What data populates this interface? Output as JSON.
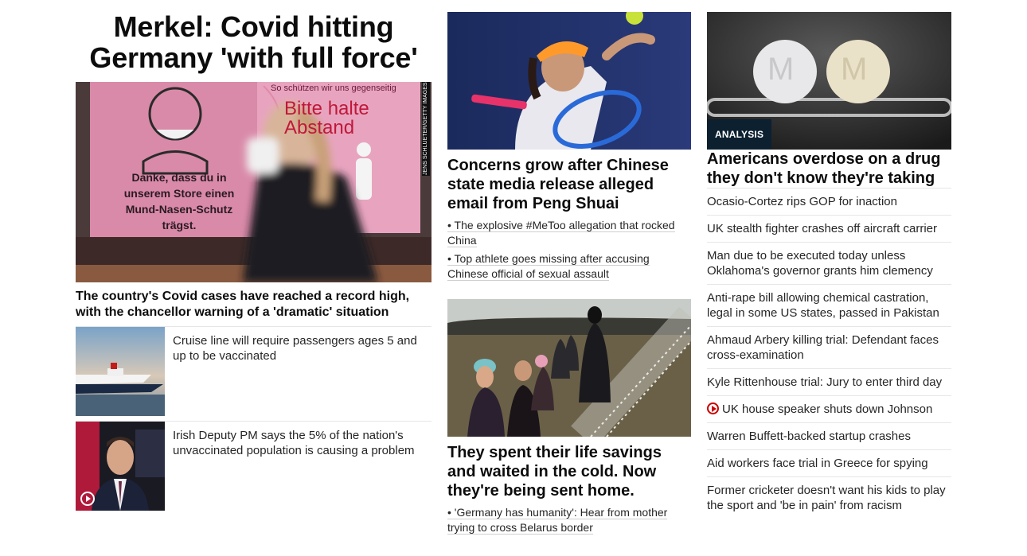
{
  "lead": {
    "headline": "Merkel: Covid hitting Germany 'with full force'",
    "image_credit": "JENS SCHLUETER/GETTY IMAGES",
    "image_sign_top": "So schützen wir uns gegenseitig",
    "image_sign_big": "Bitte halte Abstand",
    "image_sign_left": "Danke, dass du in unserem Store einen Mund-Nasen-Schutz trägst.",
    "subheadline": "The country's Covid cases have reached a record high, with the chancellor warning of a 'dramatic' situation",
    "stories": [
      {
        "text": "Cruise line will require passengers ages 5 and up to be vaccinated"
      },
      {
        "text": "Irish Deputy PM says the 5% of the nation's unvaccinated population is causing a problem"
      }
    ]
  },
  "middle": {
    "card1": {
      "headline": "Concerns grow after Chinese state media release alleged email from Peng Shuai",
      "bullets": [
        "• The explosive #MeToo allegation that rocked China",
        "• Top athlete goes missing after accusing Chinese official of sexual assault"
      ]
    },
    "card2": {
      "headline": "They spent their life savings and waited in the cold. Now they're being sent home.",
      "bullets": [
        "• 'Germany has humanity': Hear from mother trying to cross Belarus border"
      ]
    }
  },
  "right": {
    "badge": "ANALYSIS",
    "pill_mark": "M",
    "headline": "Americans overdose on a drug they don't know they're taking",
    "items": [
      "Ocasio-Cortez rips GOP for inaction",
      "UK stealth fighter crashes off aircraft carrier",
      "Man due to be executed today unless Oklahoma's governor grants him clemency",
      "Anti-rape bill allowing chemical castration, legal in some US states, passed in Pakistan",
      "Ahmaud Arbery killing trial: Defendant faces cross-examination",
      "Kyle Rittenhouse trial: Jury to enter third day",
      "UK house speaker shuts down Johnson",
      "Warren Buffett-backed startup crashes",
      "Aid workers face trial in Greece for spying",
      "Former cricketer doesn't want his kids to play the sport and 'be in pain' from racism"
    ]
  },
  "icons": {
    "video_play_red": "play-circle-icon",
    "video_play_white": "play-circle-icon"
  },
  "colors": {
    "text": "#0c0c0c",
    "divider": "#e6e6e6",
    "badge_bg": "#0c2030",
    "video_red": "#cc0000"
  }
}
